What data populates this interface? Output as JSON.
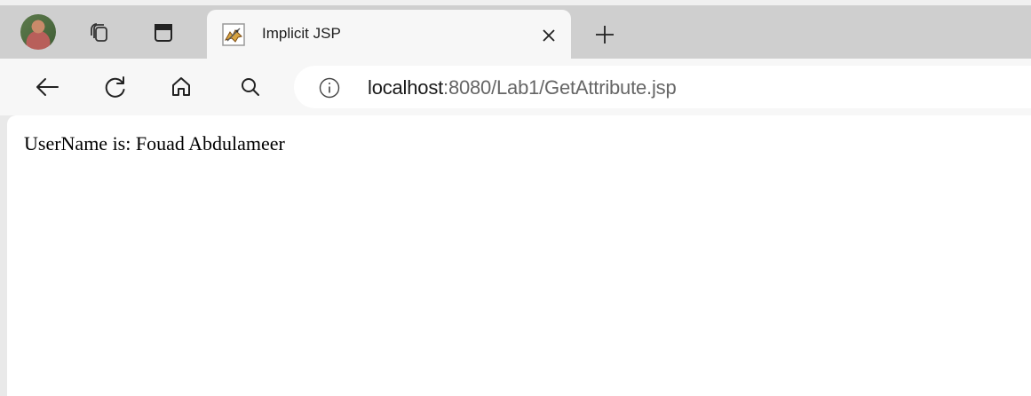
{
  "browser": {
    "tab": {
      "title": "Implicit JSP",
      "favicon": "tomcat-icon",
      "close_icon": "close-icon"
    },
    "tab_strip_icons": [
      "profile-avatar",
      "workspaces-icon",
      "vertical-tabs-icon",
      "new-tab-icon"
    ],
    "toolbar_icons": [
      "back-icon",
      "refresh-icon",
      "home-icon",
      "search-icon",
      "info-icon"
    ],
    "address_bar": {
      "host": "localhost",
      "path": ":8080/Lab1/GetAttribute.jsp"
    }
  },
  "page": {
    "text": "UserName is: Fouad Abdulameer"
  },
  "colors": {
    "tab_strip": "#cfcfcf",
    "toolbar": "#f7f7f7",
    "content_bg": "#ffffff",
    "url_host": "#1a1a1a",
    "url_path": "#666666"
  }
}
